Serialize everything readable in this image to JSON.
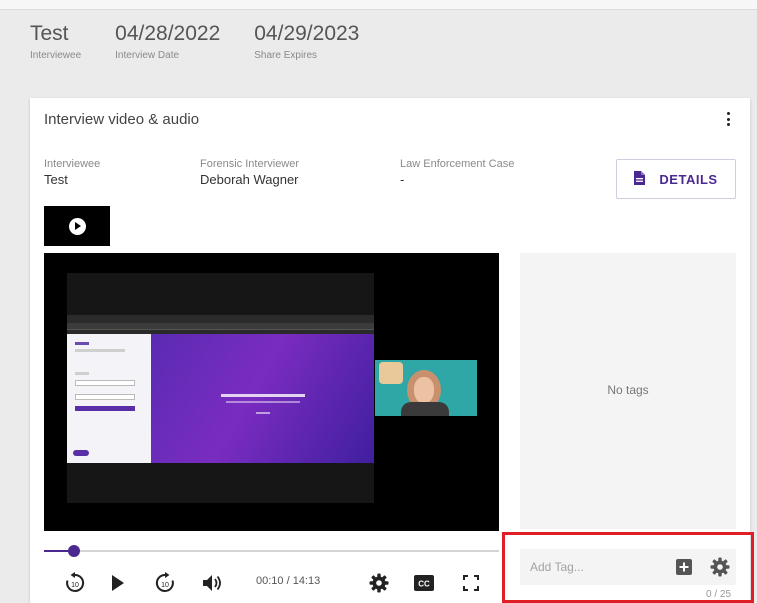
{
  "header": {
    "stats": [
      {
        "value": "Test",
        "label": "Interviewee"
      },
      {
        "value": "04/28/2022",
        "label": "Interview Date"
      },
      {
        "value": "04/29/2023",
        "label": "Share Expires"
      }
    ]
  },
  "card": {
    "title": "Interview video & audio",
    "menu_icon": "more-vert-icon",
    "meta": [
      {
        "label": "Interviewee",
        "value": "Test"
      },
      {
        "label": "Forensic Interviewer",
        "value": "Deborah Wagner"
      },
      {
        "label": "Law Enforcement Case",
        "value": "-"
      }
    ],
    "details_button": {
      "label": "DETAILS",
      "icon": "document-icon"
    }
  },
  "player": {
    "current_time": "00:10",
    "duration": "14:13",
    "time_display": "00:10 / 14:13",
    "progress_fraction": 0.012,
    "controls": [
      "rewind-10-icon",
      "play-icon",
      "forward-10-icon",
      "volume-icon",
      "settings-icon",
      "closed-captions-icon",
      "fullscreen-icon"
    ]
  },
  "tags": {
    "empty_text": "No tags",
    "input_placeholder": "Add Tag...",
    "counter": "0 / 25"
  },
  "colors": {
    "accent": "#4b2890",
    "highlight": "#e01e28"
  }
}
